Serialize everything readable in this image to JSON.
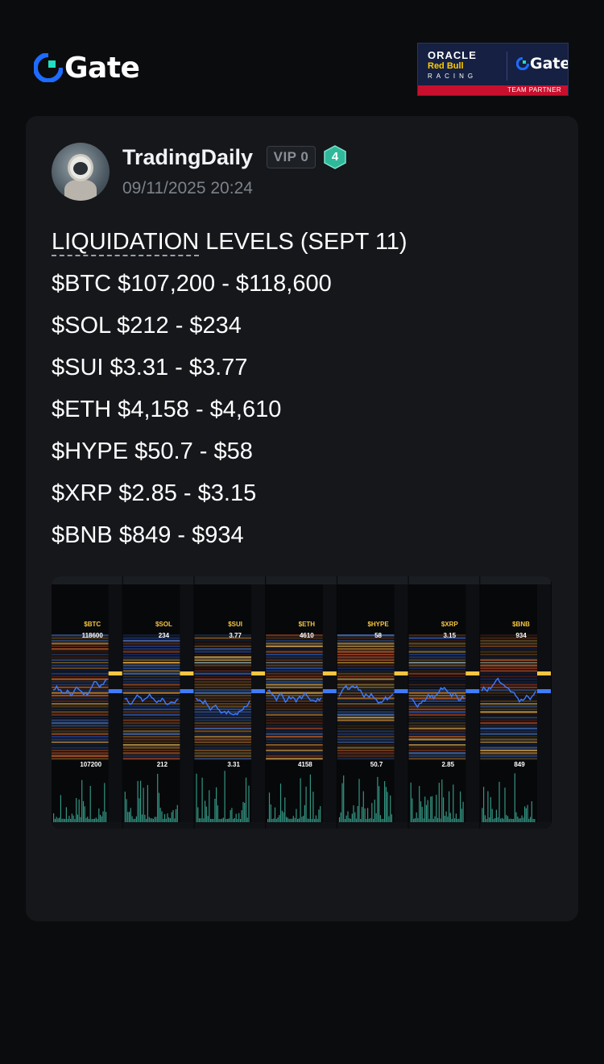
{
  "header": {
    "logo_text": "Gate",
    "partner": {
      "oracle": "ORACLE",
      "redbull": "Red Bull",
      "racing": "RACING",
      "gate_text": "Gate",
      "strip_text": "TEAM PARTNER"
    }
  },
  "post": {
    "author": "TradingDaily",
    "vip_badge": "VIP 0",
    "level": "4",
    "timestamp": "09/11/2025 20:24",
    "title_underlined": "LIQUIDATION",
    "title_rest": " LEVELS (SEPT 11)",
    "lines": [
      "$BTC $107,200 - $118,600",
      "$SOL $212 - $234",
      "$SUI $3.31 - $3.77",
      "$ETH $4,158 - $4,610",
      "$HYPE $50.7 - $58",
      "$XRP $2.85 - $3.15",
      "$BNB $849 - $934"
    ]
  },
  "image": {
    "panels": [
      {
        "ticker": "$BTC",
        "high": "118600",
        "low": "107200"
      },
      {
        "ticker": "$SOL",
        "high": "234",
        "low": "212"
      },
      {
        "ticker": "$SUI",
        "high": "3.77",
        "low": "3.31"
      },
      {
        "ticker": "$ETH",
        "high": "4610",
        "low": "4158"
      },
      {
        "ticker": "$HYPE",
        "high": "58",
        "low": "50.7"
      },
      {
        "ticker": "$XRP",
        "high": "3.15",
        "low": "2.85"
      },
      {
        "ticker": "$BNB",
        "high": "934",
        "low": "849"
      }
    ]
  },
  "colors": {
    "accent_blue": "#1e6bff",
    "level_badge": "#2fb89a",
    "background": "#0b0c0e",
    "card": "#15171b"
  }
}
